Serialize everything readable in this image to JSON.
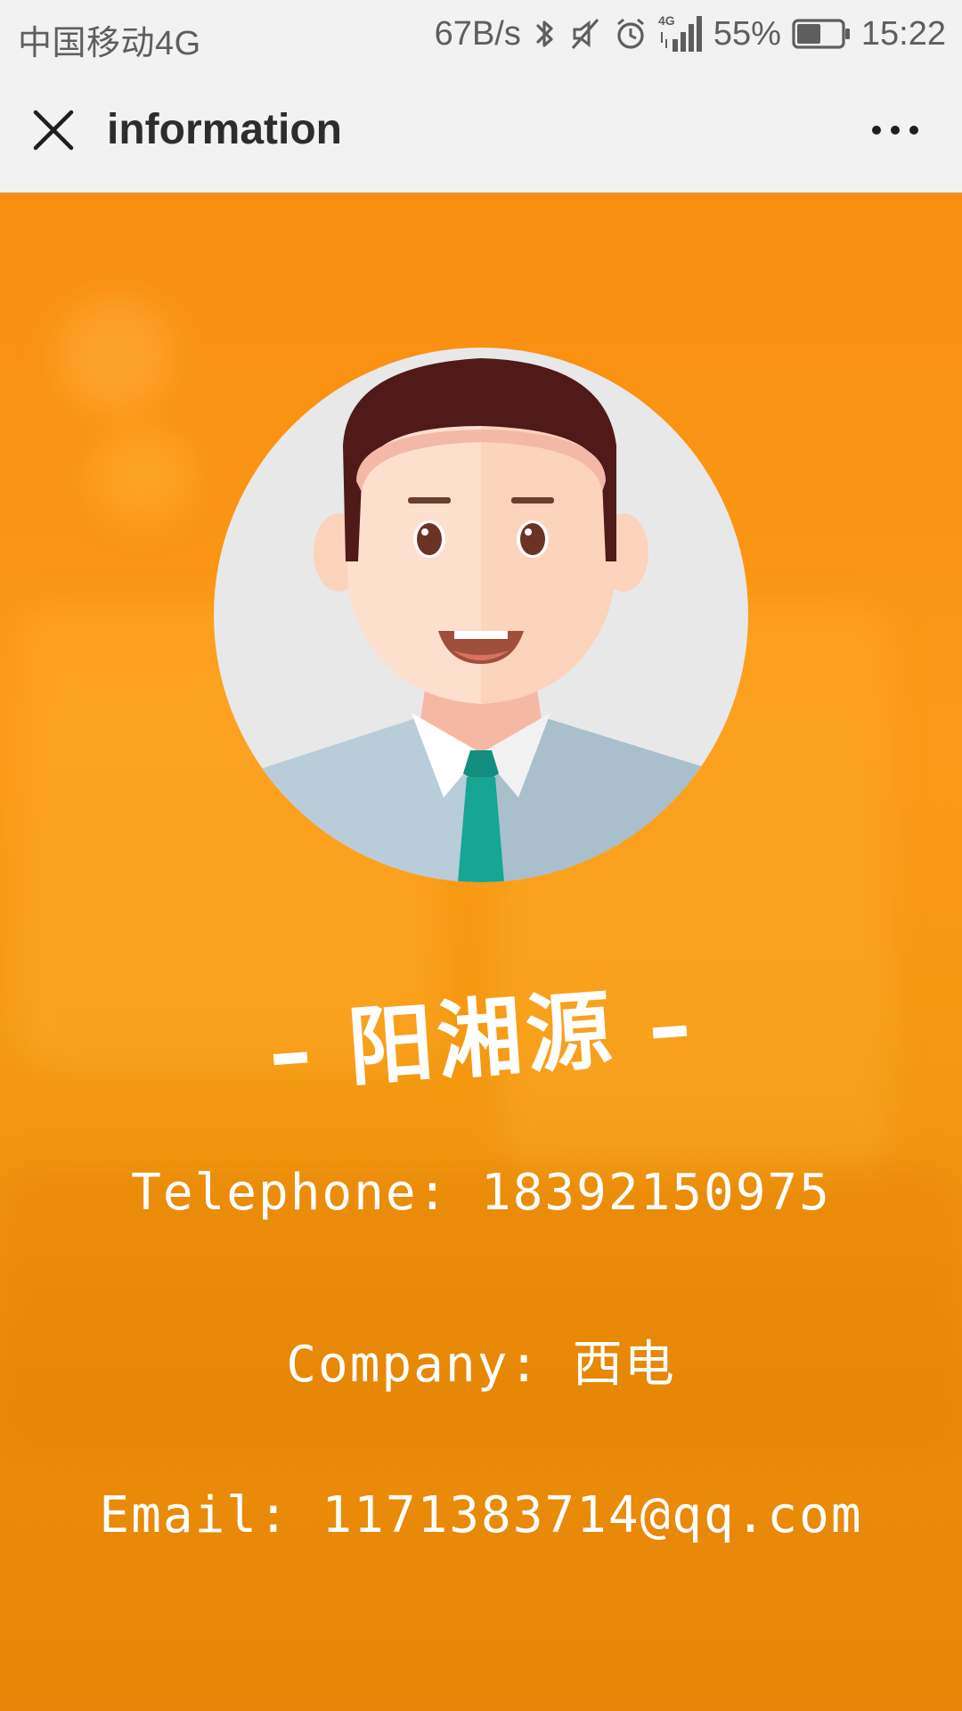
{
  "status_bar": {
    "carrier": "中国移动4G",
    "network_speed": "67B/s",
    "network_type": "4G",
    "battery": "55%",
    "battery_level": 0.55,
    "time": "15:22",
    "icons": [
      "bluetooth-icon",
      "mute-icon",
      "alarm-icon",
      "signal-icon",
      "battery-icon"
    ]
  },
  "nav": {
    "title": "information",
    "close_icon": "close-icon",
    "more_icon": "more-icon"
  },
  "profile": {
    "name": "– 阳湘源 –",
    "phone": "Telephone: 18392150975",
    "company": "Company: 西电",
    "email": "Email: 1171383714@qq.com"
  },
  "colors": {
    "background_orange": "#fb9a16",
    "status_text": "#5e5e5e",
    "title_text": "#2d2d2d",
    "hair": "#4f1a17",
    "skin": "#fcd3bb",
    "shirt": "#b8ccd8",
    "tie": "#17a594"
  }
}
